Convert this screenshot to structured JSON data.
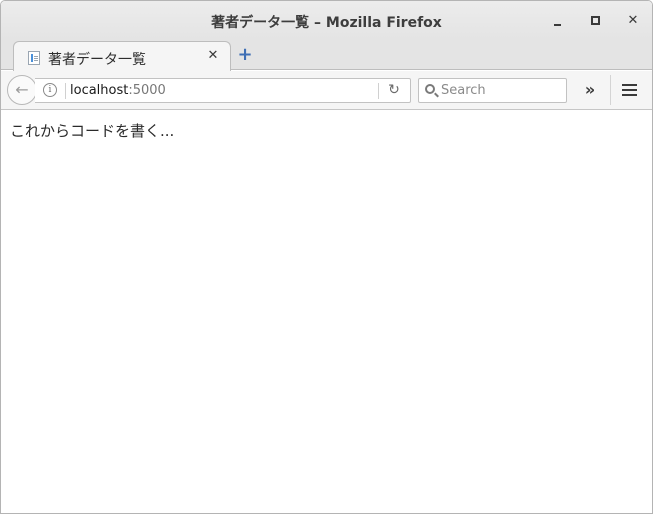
{
  "window": {
    "title": "著者データ一覧 – Mozilla Firefox",
    "minimize_icon": "minimize-icon",
    "maximize_icon": "maximize-icon",
    "close_icon": "close-icon",
    "close_glyph": "✕"
  },
  "tabs": [
    {
      "label": "著者データ一覧",
      "close_glyph": "✕",
      "active": true
    }
  ],
  "new_tab": {
    "glyph": "+"
  },
  "navbar": {
    "back_glyph": "←",
    "url_host": "localhost",
    "url_port": ":5000",
    "info_glyph": "i",
    "reload_glyph": "↻",
    "search_placeholder": "Search",
    "overflow_glyph": "»"
  },
  "page": {
    "text": "これからコードを書く..."
  },
  "colors": {
    "accent": "#3f6fb5"
  }
}
